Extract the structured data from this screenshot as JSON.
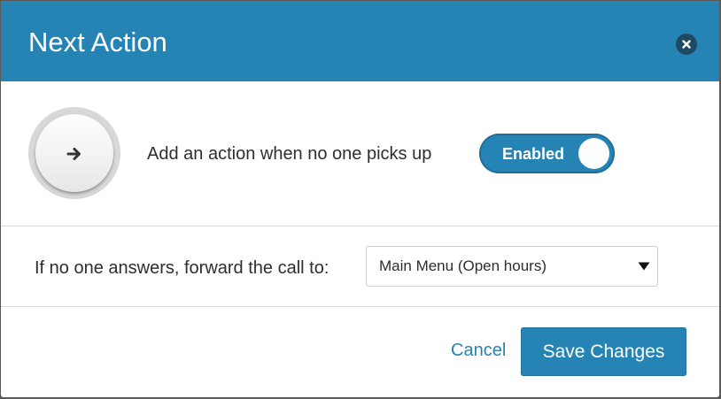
{
  "modal": {
    "title": "Next Action",
    "close_icon": "close-icon"
  },
  "action": {
    "icon": "arrow-right-icon",
    "label": "Add an action when no one picks up",
    "toggle": {
      "label": "Enabled",
      "state": true
    }
  },
  "forward": {
    "label": "If no one answers, forward the call to:",
    "select": {
      "value": "Main Menu (Open hours)",
      "caret_icon": "caret-down-icon"
    }
  },
  "footer": {
    "cancel_label": "Cancel",
    "save_label": "Save Changes"
  },
  "colors": {
    "accent": "#2584b4",
    "close_button": "#1f4a64",
    "text": "#2e2e2e",
    "overlay": "#5a5a5a"
  }
}
